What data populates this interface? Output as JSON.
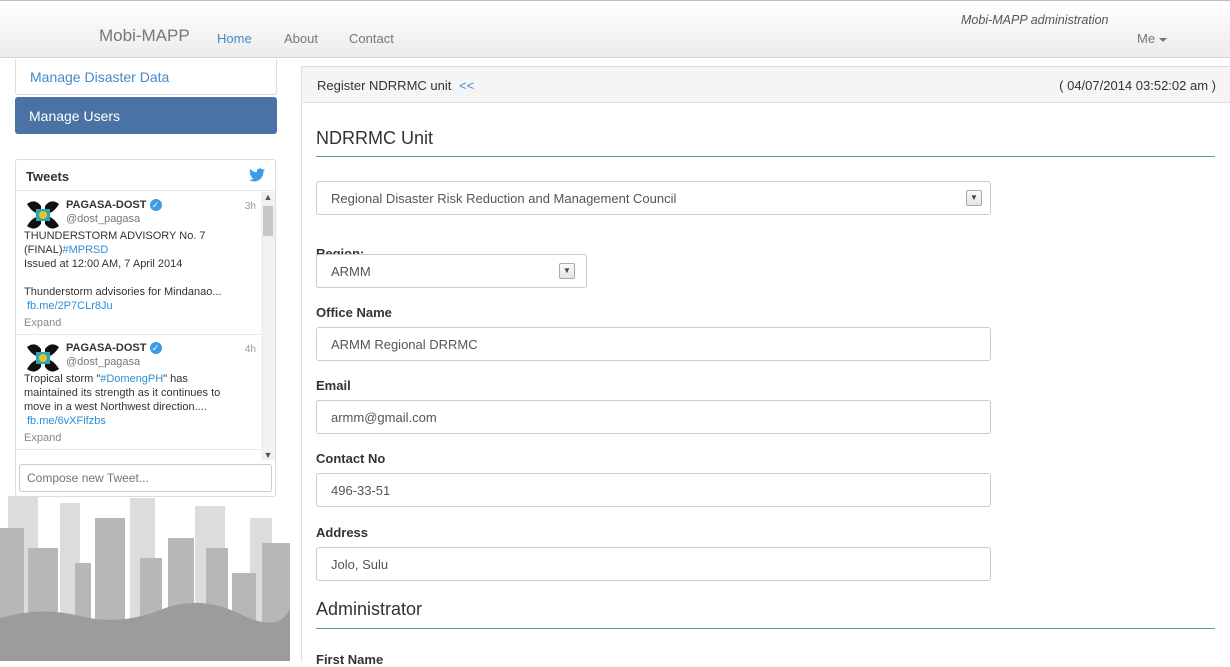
{
  "navbar": {
    "brand": "Mobi-MAPP",
    "links": [
      "Home",
      "About",
      "Contact"
    ],
    "admin_title": "Mobi-MAPP administration",
    "user_menu": "Me"
  },
  "sidebar": {
    "items": [
      {
        "label": "Manage Disaster Data"
      },
      {
        "label": "Manage Users"
      }
    ]
  },
  "tweets": {
    "title": "Tweets",
    "items": [
      {
        "name": "PAGASA-DOST",
        "handle": "@dost_pagasa",
        "time": "3h",
        "line1": "THUNDERSTORM ADVISORY No. 7",
        "line2_text": "(FINAL)",
        "line2_link": "#MPRSD",
        "line3": "Issued at 12:00 AM, 7 April 2014",
        "line4": "Thunderstorm advisories for Mindanao...",
        "url": "fb.me/2P7CLr8Ju",
        "expand": "Expand"
      },
      {
        "name": "PAGASA-DOST",
        "handle": "@dost_pagasa",
        "time": "4h",
        "line1_pre": "Tropical storm \"",
        "line1_link": "#DomengPH",
        "line1_post": "\" has",
        "line2": "maintained its strength as it continues to",
        "line3": "move in a west Northwest direction....",
        "url": "fb.me/6vXFifzbs",
        "expand": "Expand"
      }
    ],
    "compose_placeholder": "Compose new Tweet..."
  },
  "panel": {
    "title": "Register NDRRMC unit",
    "back_link": "<<",
    "timestamp": "( 04/07/2014 03:52:02 am )"
  },
  "form": {
    "unit_section": "NDRRMC Unit",
    "unit_type": "Regional Disaster Risk Reduction and Management Council",
    "region_label": "Region:",
    "region_value": "ARMM",
    "office_label": "Office Name",
    "office_value": "ARMM Regional DRRMC",
    "email_label": "Email",
    "email_value": "armm@gmail.com",
    "contact_label": "Contact No",
    "contact_value": "496-33-51",
    "address_label": "Address",
    "address_value": "Jolo, Sulu",
    "admin_section": "Administrator",
    "first_name_label": "First Name"
  }
}
